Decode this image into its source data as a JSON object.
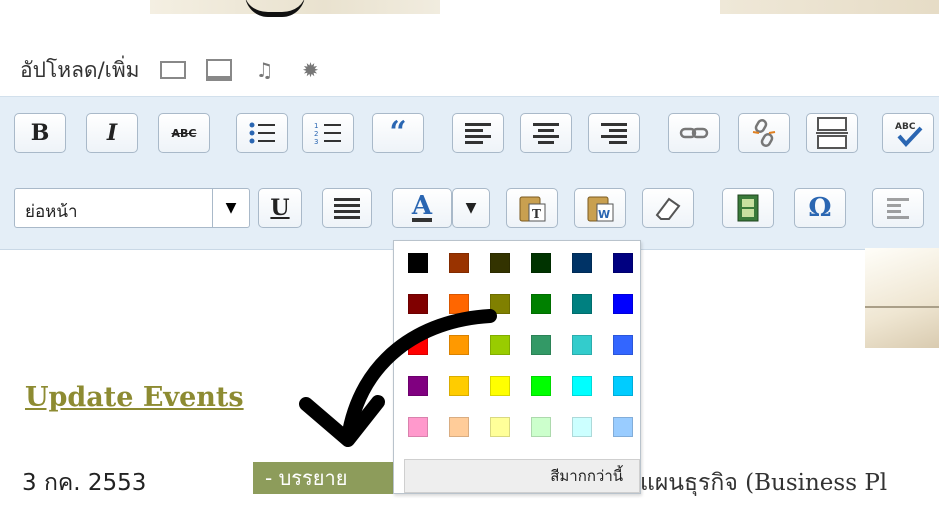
{
  "upload": {
    "label": "อัปโหลด/เพิ่ม"
  },
  "toolbar": {
    "row1": [
      {
        "name": "bold-button",
        "glyph": "B"
      },
      {
        "name": "italic-button",
        "glyph": "I"
      },
      {
        "name": "strikethrough-button",
        "glyph": "ABC"
      },
      {
        "name": "bullet-list-button",
        "glyph": ""
      },
      {
        "name": "numbered-list-button",
        "glyph": ""
      },
      {
        "name": "blockquote-button",
        "glyph": "“"
      },
      {
        "name": "align-left-button",
        "glyph": ""
      },
      {
        "name": "align-center-button",
        "glyph": ""
      },
      {
        "name": "align-right-button",
        "glyph": ""
      },
      {
        "name": "insert-link-button",
        "glyph": ""
      },
      {
        "name": "unlink-button",
        "glyph": ""
      },
      {
        "name": "insert-more-button",
        "glyph": ""
      },
      {
        "name": "spellcheck-button",
        "glyph": ""
      }
    ],
    "format_value": "ย่อหน้า",
    "underline": "U",
    "text_color": "A",
    "omega": "Ω"
  },
  "palette": {
    "more_colors": "สีมากกว่านี้",
    "colors": [
      "#000000",
      "#993300",
      "#333300",
      "#003300",
      "#003366",
      "#000080",
      "#800000",
      "#FF6600",
      "#808000",
      "#008000",
      "#008080",
      "#0000FF",
      "#FF0000",
      "#FF9900",
      "#99CC00",
      "#339966",
      "#33CCCC",
      "#3366FF",
      "#800080",
      "#FFCC00",
      "#FFFF00",
      "#00FF00",
      "#00FFFF",
      "#00CCFF",
      "#FF99CC",
      "#FFCC99",
      "#FFFF99",
      "#CCFFCC",
      "#CCFFFF",
      "#99CCFF"
    ]
  },
  "content": {
    "events_title": "Update Events",
    "event_date": "3 กค. 2553",
    "event_badge": "- บรรยาย",
    "event_rest": "แผนธุรกิจ (Business Pl"
  }
}
